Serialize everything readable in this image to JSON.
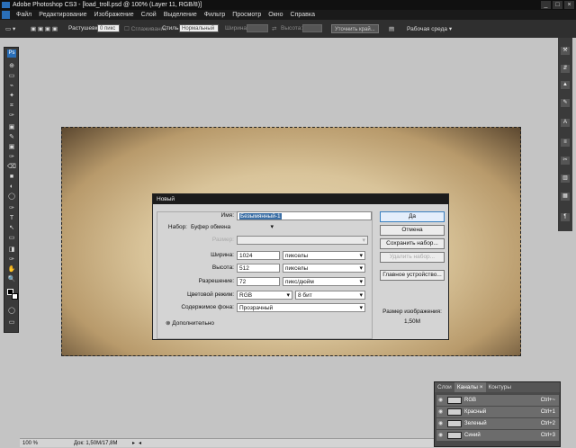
{
  "titlebar": {
    "title": "Adobe Photoshop CS3 - [load_troll.psd @ 100% (Layer 11, RGB/8)]"
  },
  "menu": {
    "items": [
      "Файл",
      "Редактирование",
      "Изображение",
      "Слой",
      "Выделение",
      "Фильтр",
      "Просмотр",
      "Окно",
      "Справка"
    ]
  },
  "options": {
    "feather_label": "Растушевка:",
    "feather_value": "0 пикс",
    "antialias_label": "Сглаживание",
    "style_label": "Стиль:",
    "style_value": "Нормальный",
    "width_label": "Ширина:",
    "height_label": "Высота:",
    "refine_edge": "Уточнить край...",
    "workspace": "Рабочая среда"
  },
  "toolbox": {
    "tools": [
      "Ps",
      "▭",
      "⊕",
      "⌗",
      "⌁",
      "✎",
      "▣",
      "⌫",
      "◐",
      "✦",
      "✑",
      "T",
      "↖",
      "◯",
      "✋",
      "🔍",
      "■",
      "◨",
      "▭",
      "⇨"
    ]
  },
  "dock": {
    "icons": [
      "⚒",
      "⇵",
      "▲",
      "✎",
      "A",
      "≡",
      "✂",
      "▥",
      "▦",
      "¶"
    ]
  },
  "dialog": {
    "title": "Новый",
    "name_label": "Имя:",
    "name_value": "Безымянный-1",
    "preset_label": "Набор:",
    "preset_value": "Буфер обмена",
    "size_label": "Размер:",
    "width_label": "Ширина:",
    "width_value": "1024",
    "width_unit": "пикселы",
    "height_label": "Высота:",
    "height_value": "512",
    "height_unit": "пикселы",
    "resolution_label": "Разрешение:",
    "resolution_value": "72",
    "resolution_unit": "пикс/дюйм",
    "color_mode_label": "Цветовой режим:",
    "color_mode_value": "RGB",
    "bit_depth": "8 бит",
    "background_label": "Содержимое фона:",
    "background_value": "Прозрачный",
    "advanced_label": "Дополнительно",
    "btn_ok": "Да",
    "btn_cancel": "Отмена",
    "btn_save_preset": "Сохранить набор...",
    "btn_delete_preset": "Удалить набор...",
    "btn_device_central": "Главное устройство...",
    "image_size_label": "Размер изображения:",
    "image_size_value": "1,50M"
  },
  "channels_panel": {
    "tabs": [
      "Слои",
      "Каналы ×",
      "Контуры"
    ],
    "channels": [
      {
        "name": "RGB",
        "shortcut": "Ctrl+~"
      },
      {
        "name": "Красный",
        "shortcut": "Ctrl+1"
      },
      {
        "name": "Зеленый",
        "shortcut": "Ctrl+2"
      },
      {
        "name": "Синий",
        "shortcut": "Ctrl+3"
      }
    ]
  },
  "status": {
    "zoom": "100 %",
    "doc": "Док: 1,50M/17,8M"
  }
}
